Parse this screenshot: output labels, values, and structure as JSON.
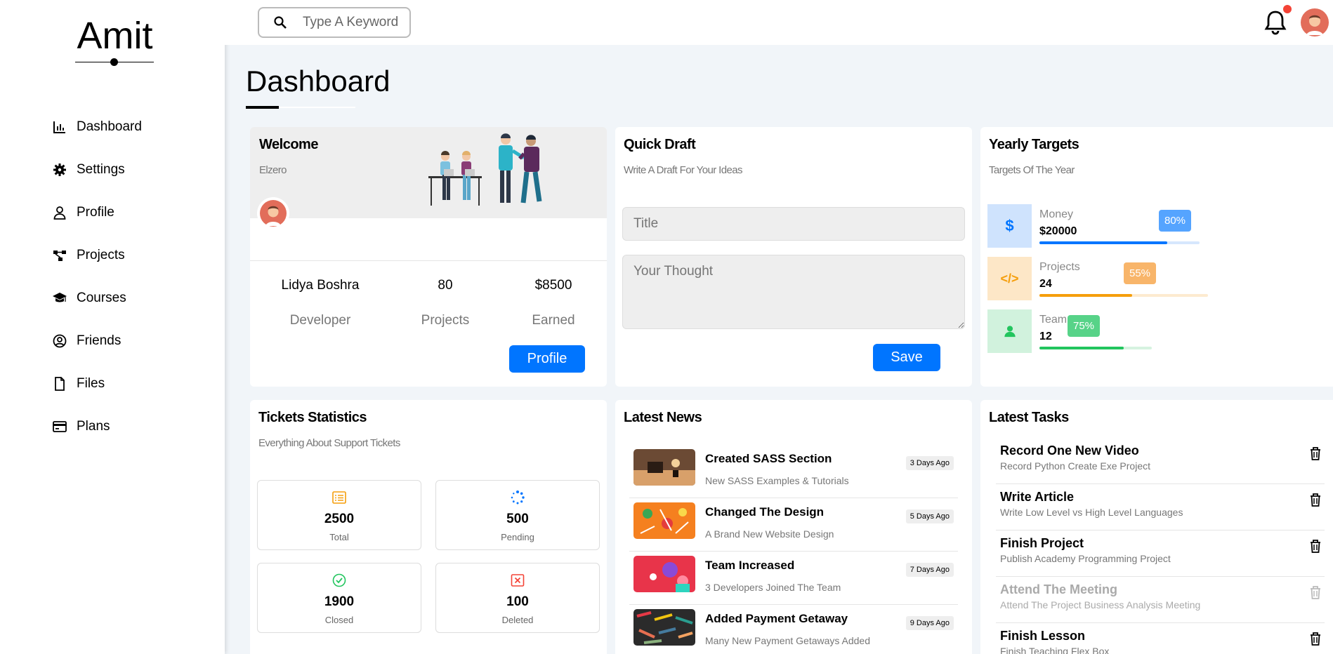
{
  "brand": "Amit",
  "sidebar": {
    "items": [
      {
        "label": "Dashboard",
        "icon": "chart-icon"
      },
      {
        "label": "Settings",
        "icon": "gear-icon"
      },
      {
        "label": "Profile",
        "icon": "user-icon"
      },
      {
        "label": "Projects",
        "icon": "diagram-icon"
      },
      {
        "label": "Courses",
        "icon": "graduation-cap-icon"
      },
      {
        "label": "Friends",
        "icon": "user-circle-icon"
      },
      {
        "label": "Files",
        "icon": "file-icon"
      },
      {
        "label": "Plans",
        "icon": "credit-card-icon"
      }
    ]
  },
  "search": {
    "placeholder": "Type A Keyword"
  },
  "page_title": "Dashboard",
  "welcome": {
    "title": "Welcome",
    "subtitle": "Elzero",
    "name": "Lidya Boshra",
    "role": "Developer",
    "projects_value": "80",
    "projects_label": "Projects",
    "earned_value": "$8500",
    "earned_label": "Earned",
    "button": "Profile"
  },
  "draft": {
    "title": "Quick Draft",
    "subtitle": "Write A Draft For Your Ideas",
    "title_placeholder": "Title",
    "thought_placeholder": "Your Thought",
    "button": "Save"
  },
  "targets": {
    "title": "Yearly Targets",
    "subtitle": "Targets Of The Year",
    "items": [
      {
        "name": "Money",
        "value": "$20000",
        "percent": "80%",
        "fraction": 0.8,
        "color": "#0075ff",
        "icon": "dollar-icon"
      },
      {
        "name": "Projects",
        "value": "24",
        "percent": "55%",
        "fraction": 0.55,
        "color": "#f59e0b",
        "icon": "code-icon"
      },
      {
        "name": "Team",
        "value": "12",
        "percent": "75%",
        "fraction": 0.75,
        "color": "#22c55e",
        "icon": "user-icon"
      }
    ]
  },
  "tickets": {
    "title": "Tickets Statistics",
    "subtitle": "Everything About Support Tickets",
    "items": [
      {
        "value": "2500",
        "label": "Total",
        "icon": "list-icon",
        "color": "#f59e0b"
      },
      {
        "value": "500",
        "label": "Pending",
        "icon": "spinner-icon",
        "color": "#0075ff"
      },
      {
        "value": "1900",
        "label": "Closed",
        "icon": "check-circle-icon",
        "color": "#22c55e"
      },
      {
        "value": "100",
        "label": "Deleted",
        "icon": "x-square-icon",
        "color": "#f44336"
      }
    ]
  },
  "news": {
    "title": "Latest News",
    "items": [
      {
        "title": "Created SASS Section",
        "desc": "New SASS Examples & Tutorials",
        "date": "3 Days Ago"
      },
      {
        "title": "Changed The Design",
        "desc": "A Brand New Website Design",
        "date": "5 Days Ago"
      },
      {
        "title": "Team Increased",
        "desc": "3 Developers Joined The Team",
        "date": "7 Days Ago"
      },
      {
        "title": "Added Payment Getaway",
        "desc": "Many New Payment Getaways Added",
        "date": "9 Days Ago"
      }
    ]
  },
  "tasks": {
    "title": "Latest Tasks",
    "items": [
      {
        "title": "Record One New Video",
        "desc": "Record Python Create Exe Project",
        "done": false
      },
      {
        "title": "Write Article",
        "desc": "Write Low Level vs High Level Languages",
        "done": false
      },
      {
        "title": "Finish Project",
        "desc": "Publish Academy Programming Project",
        "done": false
      },
      {
        "title": "Attend The Meeting",
        "desc": "Attend The Project Business Analysis Meeting",
        "done": true
      },
      {
        "title": "Finish Lesson",
        "desc": "Finish Teaching Flex Box",
        "done": false
      }
    ]
  }
}
